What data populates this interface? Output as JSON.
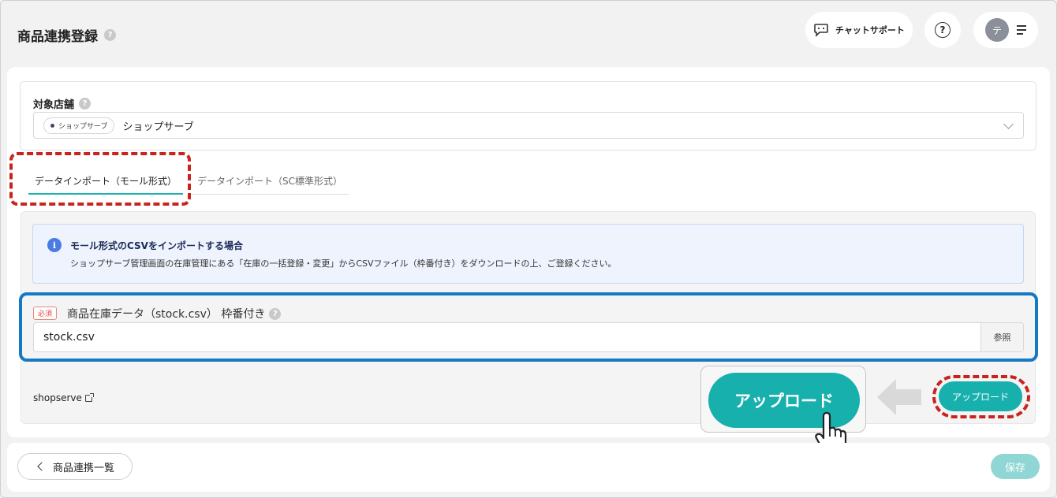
{
  "header": {
    "title": "商品連携登録",
    "help_icon": "?",
    "chat_support_label": "チャットサポート",
    "help_button_icon": "?",
    "avatar_initial": "テ"
  },
  "store": {
    "label": "対象店舗",
    "help_icon": "?",
    "chip_label": "ショップサーブ",
    "selected_value": "ショップサーブ"
  },
  "tabs": [
    {
      "label": "データインポート（モール形式）",
      "active": true
    },
    {
      "label": "データインポート（SC標準形式）",
      "active": false
    }
  ],
  "info": {
    "icon": "i",
    "title": "モール形式のCSVをインポートする場合",
    "text": "ショップサーブ管理画面の在庫管理にある「在庫の一括登録・変更」からCSVファイル（枠番付き）をダウンロードの上、ご登録ください。"
  },
  "file_field": {
    "required_badge": "必須",
    "label": "商品在庫データ（stock.csv） 枠番付き",
    "help_icon": "?",
    "value": "stock.csv",
    "browse_label": "参照"
  },
  "link": {
    "label": "shopserve"
  },
  "callout": {
    "upload_big_label": "アップロード"
  },
  "actions": {
    "upload_label": "アップロード"
  },
  "footer": {
    "back_label": "商品連携一覧",
    "save_label": "保存"
  },
  "colors": {
    "accent": "#18b0ad",
    "highlight_red": "#c9231f",
    "highlight_blue": "#1579c4",
    "info_icon": "#4b7be3"
  }
}
